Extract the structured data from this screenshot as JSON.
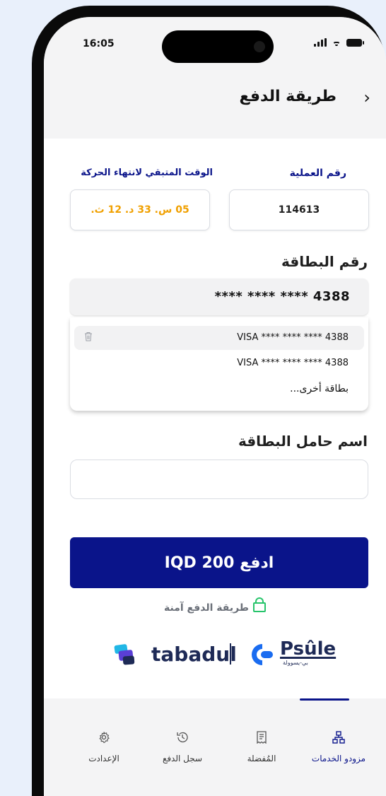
{
  "status_bar": {
    "time": "16:05"
  },
  "header": {
    "title": "طريقة الدفع",
    "back_icon": "chevron-right-icon"
  },
  "transaction": {
    "id_label": "رقم العملية",
    "id_value": "114613",
    "time_label": "الوقت المتبقي لانتهاء الحركة",
    "time_value": "05 س. 33 د. 12 ث."
  },
  "card": {
    "label": "رقم البطاقة",
    "selected": "**** **** **** 4388",
    "options": [
      {
        "text": "VISA **** **** **** 4388",
        "highlighted": true,
        "icon": "trash-icon"
      },
      {
        "text": "VISA **** **** **** 4388",
        "highlighted": false
      },
      {
        "text": "بطاقة أخرى..."
      }
    ]
  },
  "holder": {
    "label": "اسم حامل البطاقة",
    "value": ""
  },
  "pay_button": {
    "label": "ادفع 200 IQD"
  },
  "secure_text": "طريقة الدفع آمنة",
  "logos": {
    "tabadul": "tabadul",
    "psule": "Psûle",
    "psule_sub": "بي-يسوولة"
  },
  "tabs": [
    {
      "label": "مزودو الخدمات",
      "icon": "sitemap-icon",
      "active": true
    },
    {
      "label": "المُفضلة",
      "icon": "receipt-icon",
      "active": false
    },
    {
      "label": "سجل الدفع",
      "icon": "history-icon",
      "active": false
    },
    {
      "label": "الإعدادت",
      "icon": "gear-icon",
      "active": false
    }
  ],
  "colors": {
    "primary": "#0a148a",
    "accent_orange": "#f0a000",
    "secure_green": "#27c46b",
    "tab_bg": "#f4f4f5"
  }
}
